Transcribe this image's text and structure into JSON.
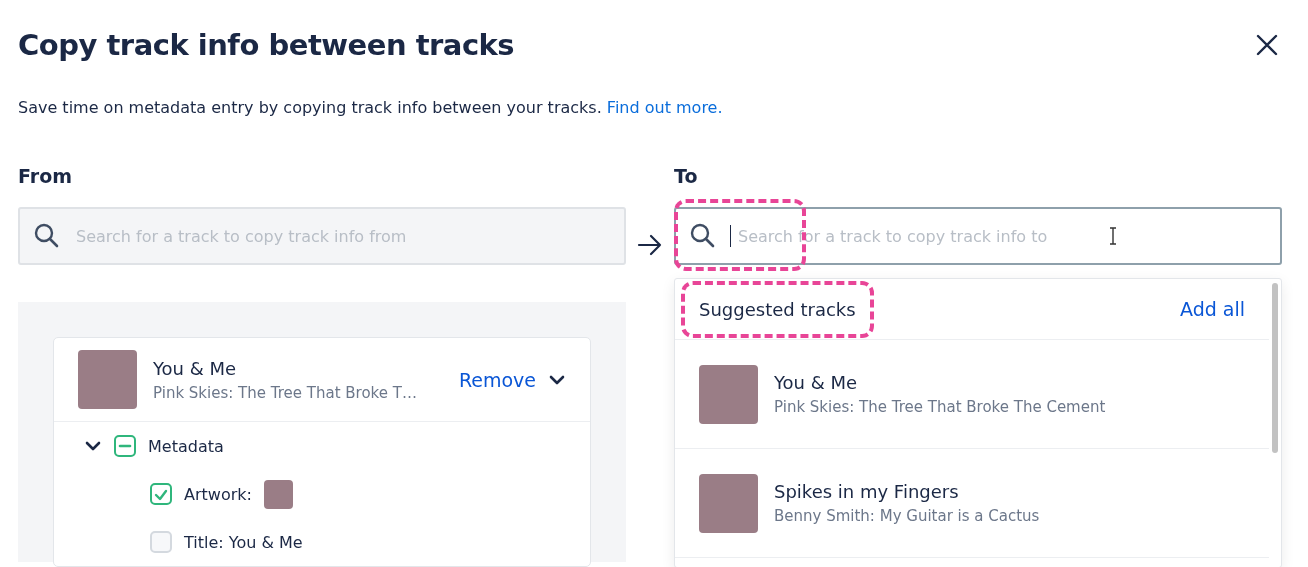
{
  "dialog": {
    "title": "Copy track info between tracks",
    "description": "Save time on metadata entry by copying track info between your tracks.",
    "link": "Find out more."
  },
  "from": {
    "label": "From",
    "search": {
      "placeholder": "Search for a track to copy track info from"
    },
    "track": {
      "title": "You & Me",
      "subtitle": "Pink Skies: The Tree That Broke T…",
      "action": "Remove",
      "expanded": true,
      "groups": [
        {
          "label": "Metadata",
          "expanded": true,
          "checked": true,
          "indeterminate": true,
          "children": [
            {
              "kind": "artwork",
              "label": "Artwork:",
              "checked": true
            },
            {
              "kind": "text",
              "label": "Title: You & Me",
              "checked": false
            }
          ]
        }
      ]
    }
  },
  "to": {
    "label": "To",
    "search": {
      "placeholder": "Search for a track to copy track info to",
      "focused": true,
      "icon_highlighted": true
    },
    "suggestions": {
      "heading": "Suggested tracks",
      "heading_highlighted": true,
      "action": "Add all",
      "tracks": [
        {
          "title": "You & Me",
          "subtitle": "Pink Skies: The Tree That Broke The Cement"
        },
        {
          "title": "Spikes in my Fingers",
          "subtitle": "Benny Smith: My Guitar is a Cactus"
        }
      ]
    }
  }
}
